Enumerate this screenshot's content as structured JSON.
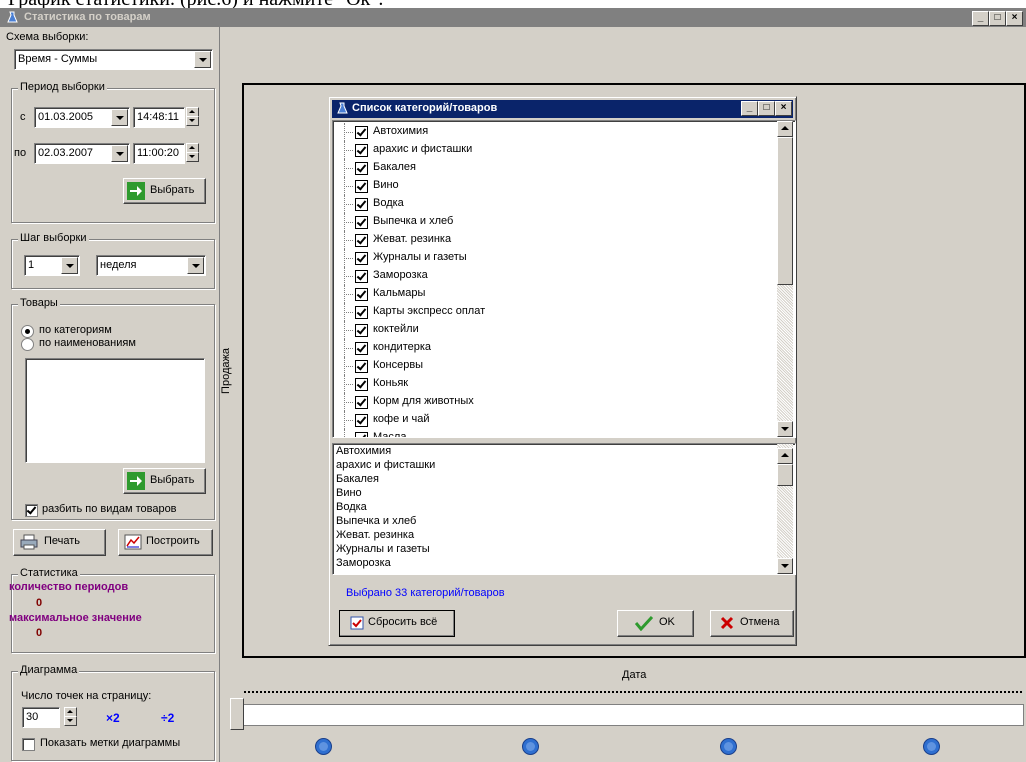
{
  "doc_text": "График статистики. (рис.6) и нажмите \"Ок\".",
  "window": {
    "title": "Статистика по товарам",
    "min": "_",
    "max": "□",
    "close": "×"
  },
  "left": {
    "scheme_label": "Схема выборки:",
    "scheme_value": "Время - Суммы",
    "period_title": "Период выборки",
    "from_label": "с",
    "from_date": "01.03.2005",
    "from_time": "14:48:11",
    "to_label": "по",
    "to_date": "02.03.2007",
    "to_time": "11:00:20",
    "select_button": "Выбрать",
    "step_title": "Шаг выборки",
    "step_value": "1",
    "step_unit": "неделя",
    "goods_title": "Товары",
    "by_category": "по категориям",
    "by_name": "по наименованиям",
    "select_button2": "Выбрать",
    "split_label": "разбить по видам товаров",
    "print_button": "Печать",
    "build_button": "Построить",
    "stats_title": "Статистика",
    "periods_label": "количество периодов",
    "periods_value": "0",
    "max_label": "максимальное значение",
    "max_value": "0",
    "diagram_title": "Диаграмма",
    "points_label": "Число точек на страницу:",
    "points_value": "30",
    "x2": "×2",
    "div2": "÷2",
    "show_marks": "Показать метки диаграммы"
  },
  "chart": {
    "ylabel": "Продажа",
    "xlabel": "Дата"
  },
  "dialog": {
    "title": "Список категорий/товаров",
    "min": "_",
    "max": "□",
    "close": "×",
    "tree_items": [
      "Автохимия",
      "арахис и фисташки",
      "Бакалея",
      "Вино",
      "Водка",
      "Выпечка и хлеб",
      "Жеват. резинка",
      "Журналы и газеты",
      "Заморозка",
      "Кальмары",
      "Карты экспресс оплат",
      "коктейли",
      "кондитерка",
      "Консервы",
      "Коньяк",
      "Корм для животных",
      "кофе и чай",
      "Масла"
    ],
    "list_items": [
      "Автохимия",
      "арахис и фисташки",
      "Бакалея",
      "Вино",
      "Водка",
      "Выпечка и хлеб",
      "Жеват. резинка",
      "Журналы и газеты",
      "Заморозка"
    ],
    "selected_text": "Выбрано 33 категорий/товаров",
    "reset_button": "Сбросить всё",
    "ok_button": "OK",
    "cancel_button": "Отмена"
  },
  "colors": {
    "accent": "#0a246a",
    "stat_label": "#800080",
    "stat_value": "#800000",
    "link": "#0000ff"
  }
}
